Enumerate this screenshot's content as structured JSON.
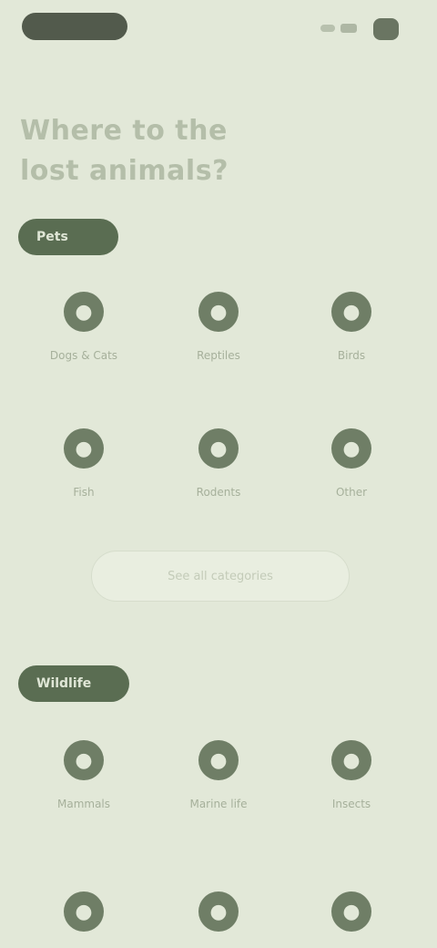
{
  "headline": "Where to the lost animals?",
  "sections": [
    {
      "label": "Pets",
      "items": [
        {
          "label": "Dogs & Cats",
          "icon": "paw-icon"
        },
        {
          "label": "Reptiles",
          "icon": "reptile-icon"
        },
        {
          "label": "Birds",
          "icon": "bird-icon"
        },
        {
          "label": "Fish",
          "icon": "fish-icon"
        },
        {
          "label": "Rodents",
          "icon": "rodent-icon"
        },
        {
          "label": "Other",
          "icon": "other-icon"
        }
      ],
      "more_label": "See all categories"
    },
    {
      "label": "Wildlife",
      "items": [
        {
          "label": "Mammals",
          "icon": "mammal-icon"
        },
        {
          "label": "Marine life",
          "icon": "marine-icon"
        },
        {
          "label": "Insects",
          "icon": "insect-icon"
        },
        {
          "label": "",
          "icon": "leaf-icon"
        },
        {
          "label": "",
          "icon": "tree-icon"
        },
        {
          "label": "",
          "icon": "flower-icon"
        }
      ]
    }
  ],
  "colors": {
    "background": "#e2e8d8",
    "accent": "#5a6d52",
    "icon": "#6f7e66"
  }
}
